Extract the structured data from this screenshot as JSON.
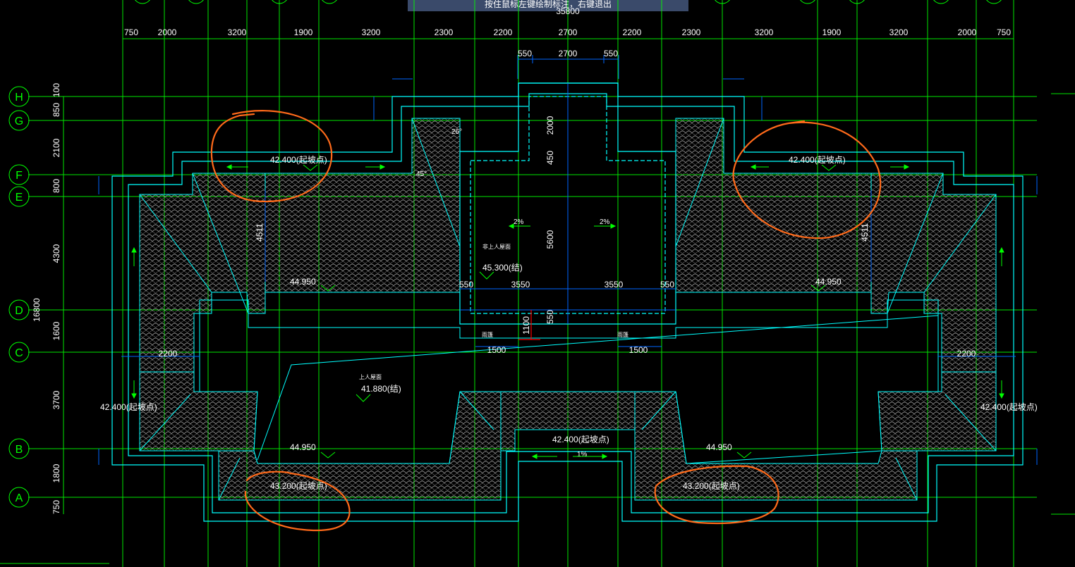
{
  "hint": "按住鼠标左键绘制标注，右键退出",
  "colors": {
    "background": "#000000",
    "axis": "#00ff00",
    "outline": "#00ffff",
    "dimension": "#0066ff",
    "arrow": "#00ff00",
    "annotation": "#ff6a1a",
    "marker": "#ff0000"
  },
  "axes": {
    "rows": [
      "H",
      "G",
      "F",
      "E",
      "D",
      "C",
      "B",
      "A"
    ],
    "left_dims": [
      "100",
      "850",
      "2100",
      "800",
      "4300",
      "1600",
      "3700",
      "1800",
      "750"
    ],
    "total_dim": "16800"
  },
  "top_dims": {
    "overall": "35800",
    "row1": [
      "750",
      "2000",
      "3200",
      "1900",
      "3200",
      "2300",
      "2200",
      "2700",
      "2200",
      "2300",
      "3200",
      "1900",
      "3200",
      "2000",
      "750"
    ],
    "row2": [
      "550",
      "2700",
      "550"
    ]
  },
  "labels": {
    "elev_center": "45.300(结)",
    "center_roof": "非上人屋面",
    "elev_terrace": "41.880(结)",
    "terrace_roof": "上人屋面",
    "elev_nw": "42.400(起坡点)",
    "elev_ne": "42.400(起坡点)",
    "elev_w": "42.400(起坡点)",
    "elev_e": "42.400(起坡点)",
    "elev_mid": "42.400(起坡点)",
    "elev_sw": "43.200(起坡点)",
    "elev_se": "43.200(起坡点)",
    "ridge_l1": "44.950",
    "ridge_r1": "44.950",
    "ridge_l2": "44.950",
    "ridge_r2": "44.950",
    "canopy": "雨篷",
    "canopy2": "雨篷",
    "dim_5600": "5600",
    "dim_3550a": "3550",
    "dim_3550b": "3550",
    "dim_550a": "550",
    "dim_550b": "550",
    "dim_2000": "2000",
    "dim_450": "450",
    "dim_1100": "1100",
    "dim_1500a": "1500",
    "dim_1500b": "1500",
    "dim_2200a": "2200",
    "dim_2200b": "2200",
    "dim_4511a": "4511",
    "dim_4511b": "4511",
    "slope_2a": "2%",
    "slope_2b": "2%",
    "slope_1": "1%",
    "deg_26": "26°",
    "deg_45": "45°"
  }
}
